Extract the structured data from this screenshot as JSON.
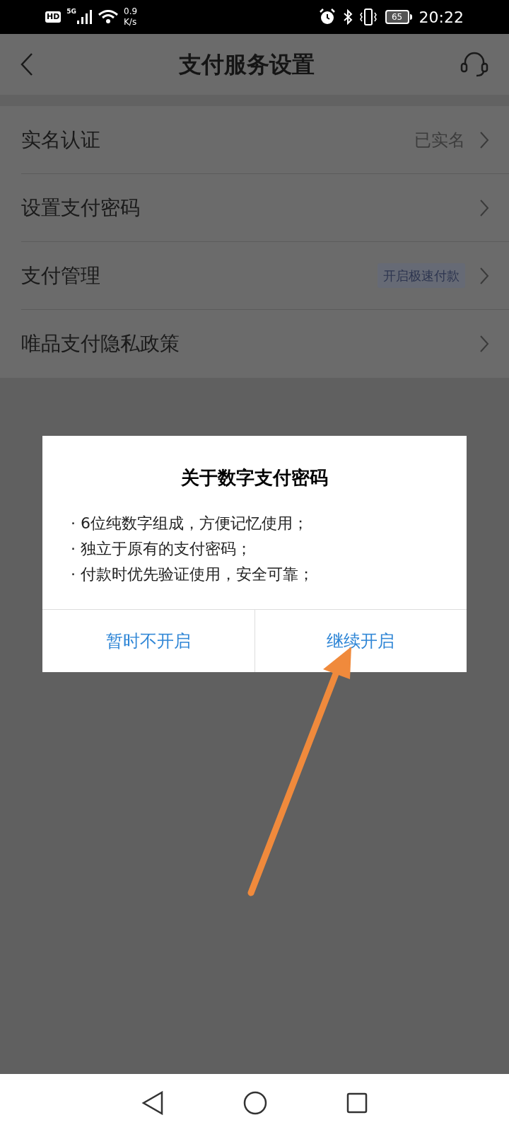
{
  "status_bar": {
    "hd": "HD",
    "network": "5G",
    "speed_value": "0.9",
    "speed_unit": "K/s",
    "battery": "65",
    "time": "20:22"
  },
  "header": {
    "title": "支付服务设置"
  },
  "settings": [
    {
      "label": "实名认证",
      "value": "已实名",
      "kind": "text"
    },
    {
      "label": "设置支付密码",
      "kind": "plain"
    },
    {
      "label": "支付管理",
      "value": "开启极速付款",
      "kind": "tag"
    },
    {
      "label": "唯品支付隐私政策",
      "kind": "plain"
    }
  ],
  "dialog": {
    "title": "关于数字支付密码",
    "bullet": "·",
    "lines": [
      "6位纯数字组成，方便记忆使用；",
      "独立于原有的支付密码；",
      "付款时优先验证使用，安全可靠；"
    ],
    "buttons": [
      "暂时不开启",
      "继续开启"
    ]
  }
}
